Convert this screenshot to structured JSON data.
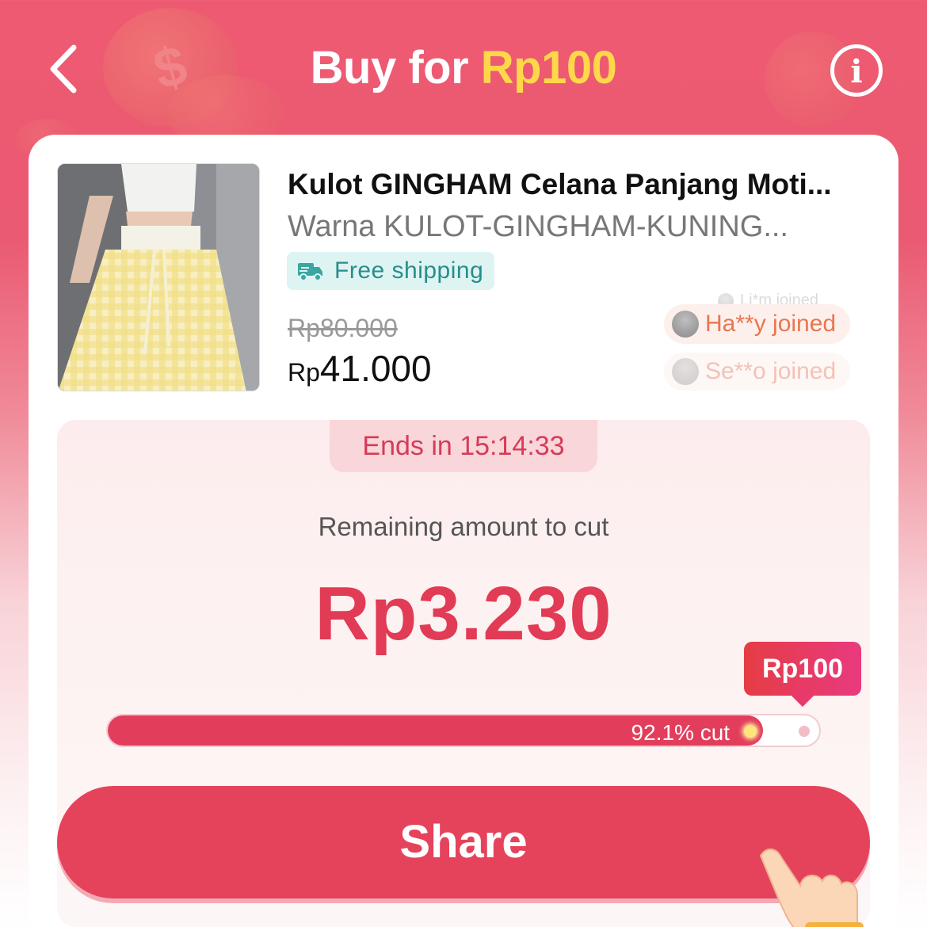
{
  "header": {
    "title_prefix": "Buy for ",
    "title_price": "Rp100",
    "info_glyph": "i"
  },
  "product": {
    "name": "Kulot GINGHAM Celana Panjang Moti...",
    "variant": "Warna KULOT-GINGHAM-KUNING...",
    "shipping_badge": "Free shipping",
    "original_price": "Rp80.000",
    "price_currency": "Rp",
    "price_amount": "41.000"
  },
  "joined_feed": [
    {
      "text": "Li*m joined"
    },
    {
      "text": "Ha**y joined"
    },
    {
      "text": "Se**o joined"
    }
  ],
  "cut": {
    "ends_in": "Ends in 15:14:33",
    "remaining_label": "Remaining amount to cut",
    "remaining_amount": "Rp3.230",
    "target_tag": "Rp100",
    "progress_label": "92.1% cut",
    "progress_percent": 92.1
  },
  "share_button": "Share",
  "colors": {
    "brand": "#e5435c",
    "accent_yellow": "#ffd84a",
    "shipping_teal": "#2a8d8a"
  },
  "icons": [
    "back-chevron-icon",
    "info-icon",
    "truck-icon",
    "pointing-hand-icon"
  ]
}
